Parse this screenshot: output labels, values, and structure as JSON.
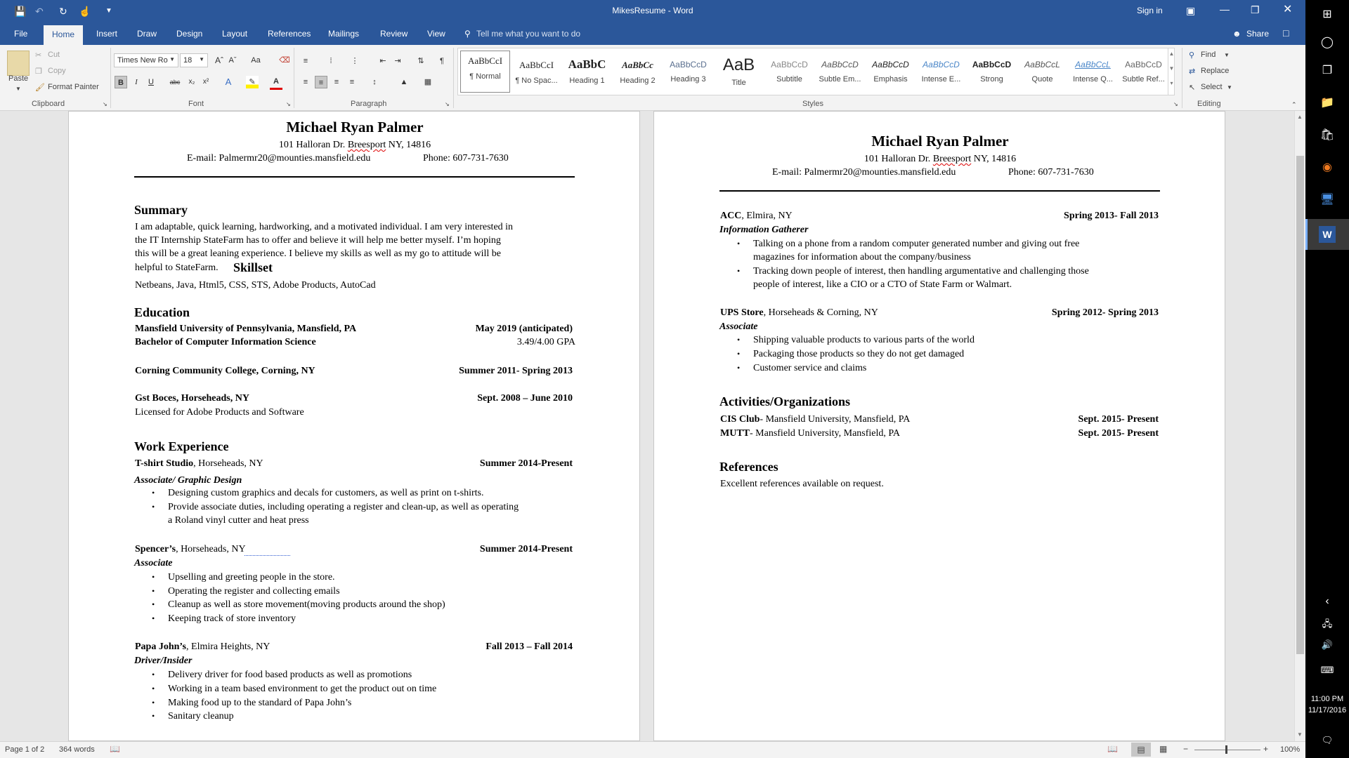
{
  "titlebar": {
    "title": "MikesResume - Word",
    "sign_in": "Sign in"
  },
  "tabs": [
    "File",
    "Home",
    "Insert",
    "Draw",
    "Design",
    "Layout",
    "References",
    "Mailings",
    "Review",
    "View"
  ],
  "tell_me": "Tell me what you want to do",
  "share": "Share",
  "ribbon": {
    "clipboard": {
      "paste": "Paste",
      "cut": "Cut",
      "copy": "Copy",
      "format_painter": "Format Painter",
      "label": "Clipboard"
    },
    "font": {
      "name": "Times New Ro",
      "size": "18",
      "label": "Font",
      "aa": "Aa"
    },
    "paragraph": {
      "label": "Paragraph"
    },
    "styles": {
      "label": "Styles",
      "items": [
        {
          "sample": "AaBbCcI",
          "name": "¶ Normal"
        },
        {
          "sample": "AaBbCcI",
          "name": "¶ No Spac..."
        },
        {
          "sample": "AaBbC",
          "name": "Heading 1"
        },
        {
          "sample": "AaBbCc",
          "name": "Heading 2"
        },
        {
          "sample": "AaBbCcD",
          "name": "Heading 3"
        },
        {
          "sample": "AaB",
          "name": "Title"
        },
        {
          "sample": "AaBbCcD",
          "name": "Subtitle"
        },
        {
          "sample": "AaBbCcD",
          "name": "Subtle Em..."
        },
        {
          "sample": "AaBbCcD",
          "name": "Emphasis"
        },
        {
          "sample": "AaBbCcD",
          "name": "Intense E..."
        },
        {
          "sample": "AaBbCcD",
          "name": "Strong"
        },
        {
          "sample": "AaBbCcL",
          "name": "Quote"
        },
        {
          "sample": "AaBbCcL",
          "name": "Intense Q..."
        },
        {
          "sample": "AaBbCcD",
          "name": "Subtle Ref..."
        }
      ]
    },
    "editing": {
      "find": "Find",
      "replace": "Replace",
      "select": "Select",
      "label": "Editing"
    }
  },
  "page1": {
    "name": "Michael Ryan Palmer",
    "address_pre": "101 Halloran Dr. ",
    "address_sq": "Breesport",
    "address_post": " NY, 14816",
    "email": "E-mail: Palmermr20@mounties.mansfield.edu",
    "phone": "Phone: 607-731-7630",
    "summary_h": "Summary",
    "summary": [
      "I am adaptable, quick learning, hardworking, and a motivated individual. I am very interested in",
      "the IT Internship StateFarm has to offer and believe it will help me better myself. I’m hoping",
      "this will be a great leaning experience. I believe my skills as well as my go to attitude will be",
      "helpful to StateFarm."
    ],
    "skillset_h": "Skillset",
    "skills": "Netbeans, Java, Html5, CSS, STS, Adobe Products, AutoCad",
    "education_h": "Education",
    "edu1_school": "Mansfield University of Pennsylvania, Mansfield, PA",
    "edu1_date": "May 2019 (anticipated)",
    "edu1_degree": "Bachelor of Computer Information Science",
    "edu1_gpa": "3.49/4.00 GPA",
    "edu2_school": "Corning Community College, Corning, NY",
    "edu2_date": "Summer 2011- Spring 2013",
    "edu3_school": "Gst Boces, Horseheads, NY",
    "edu3_date": "Sept. 2008 – June 2010",
    "edu3_note": "Licensed for Adobe Products and Software",
    "work_h": "Work Experience",
    "job1_company": "T-shirt Studio",
    "job1_loc": ", Horseheads, NY",
    "job1_date": "Summer 2014-Present",
    "job1_title": "Associate/ Graphic Design",
    "job1_bullets": [
      "Designing custom graphics and decals for customers, as well as print on t-shirts.",
      "Provide associate duties, including operating a register and clean-up, as well as operating",
      "a Roland vinyl cutter and heat press"
    ],
    "job2_company": "Spencer’s",
    "job2_loc": ", Horseheads, NY",
    "job2_date": "Summer 2014-Present",
    "job2_title": "Associate",
    "job2_bullets": [
      "Upselling and greeting people in the store.",
      "Operating the register and collecting emails",
      "Cleanup as well as store movement(moving products around the shop)",
      "Keeping track of store inventory"
    ],
    "job3_company": "Papa John’s",
    "job3_loc": ", Elmira Heights, NY",
    "job3_date": "Fall 2013 – Fall 2014",
    "job3_title": "Driver/Insider",
    "job3_bullets": [
      "Delivery driver for food based products as well as promotions",
      "Working in a team based environment to get the product out on time",
      "Making food up to the standard of Papa John’s",
      "Sanitary cleanup"
    ]
  },
  "page2": {
    "name": "Michael Ryan Palmer",
    "address_pre": "101 Halloran Dr. ",
    "address_sq": "Breesport",
    "address_post": " NY, 14816",
    "email": "E-mail: Palmermr20@mounties.mansfield.edu",
    "phone": "Phone: 607-731-7630",
    "job4_company": "ACC",
    "job4_loc": ", Elmira, NY",
    "job4_date": "Spring 2013- Fall 2013",
    "job4_title": "Information Gatherer",
    "job4_bullets": [
      "Talking on a phone from a random computer generated number and giving out free",
      "magazines for information about the company/business",
      "Tracking down people of interest, then handling argumentative and challenging those",
      "people of interest, like a CIO or a CTO of State Farm or Walmart."
    ],
    "job5_company": "UPS Store",
    "job5_loc": ", Horseheads & Corning, NY",
    "job5_date": "Spring 2012- Spring 2013",
    "job5_title": "Associate",
    "job5_bullets": [
      "Shipping valuable products to various parts of the world",
      "Packaging those products so they do not get damaged",
      "Customer service and claims"
    ],
    "activities_h": "Activities/Organizations",
    "act1_name": "CIS Club",
    "act1_loc": "- Mansfield University, Mansfield, PA",
    "act1_date": "Sept. 2015- Present",
    "act2_name": "MUTT",
    "act2_loc": "- Mansfield University, Mansfield, PA",
    "act2_date": "Sept. 2015- Present",
    "references_h": "References",
    "references": "Excellent references available on request."
  },
  "status": {
    "page": "Page 1 of 2",
    "words": "364 words",
    "zoom": "100%"
  },
  "taskbar": {
    "time": "11:00 PM",
    "date": "11/17/2016"
  }
}
